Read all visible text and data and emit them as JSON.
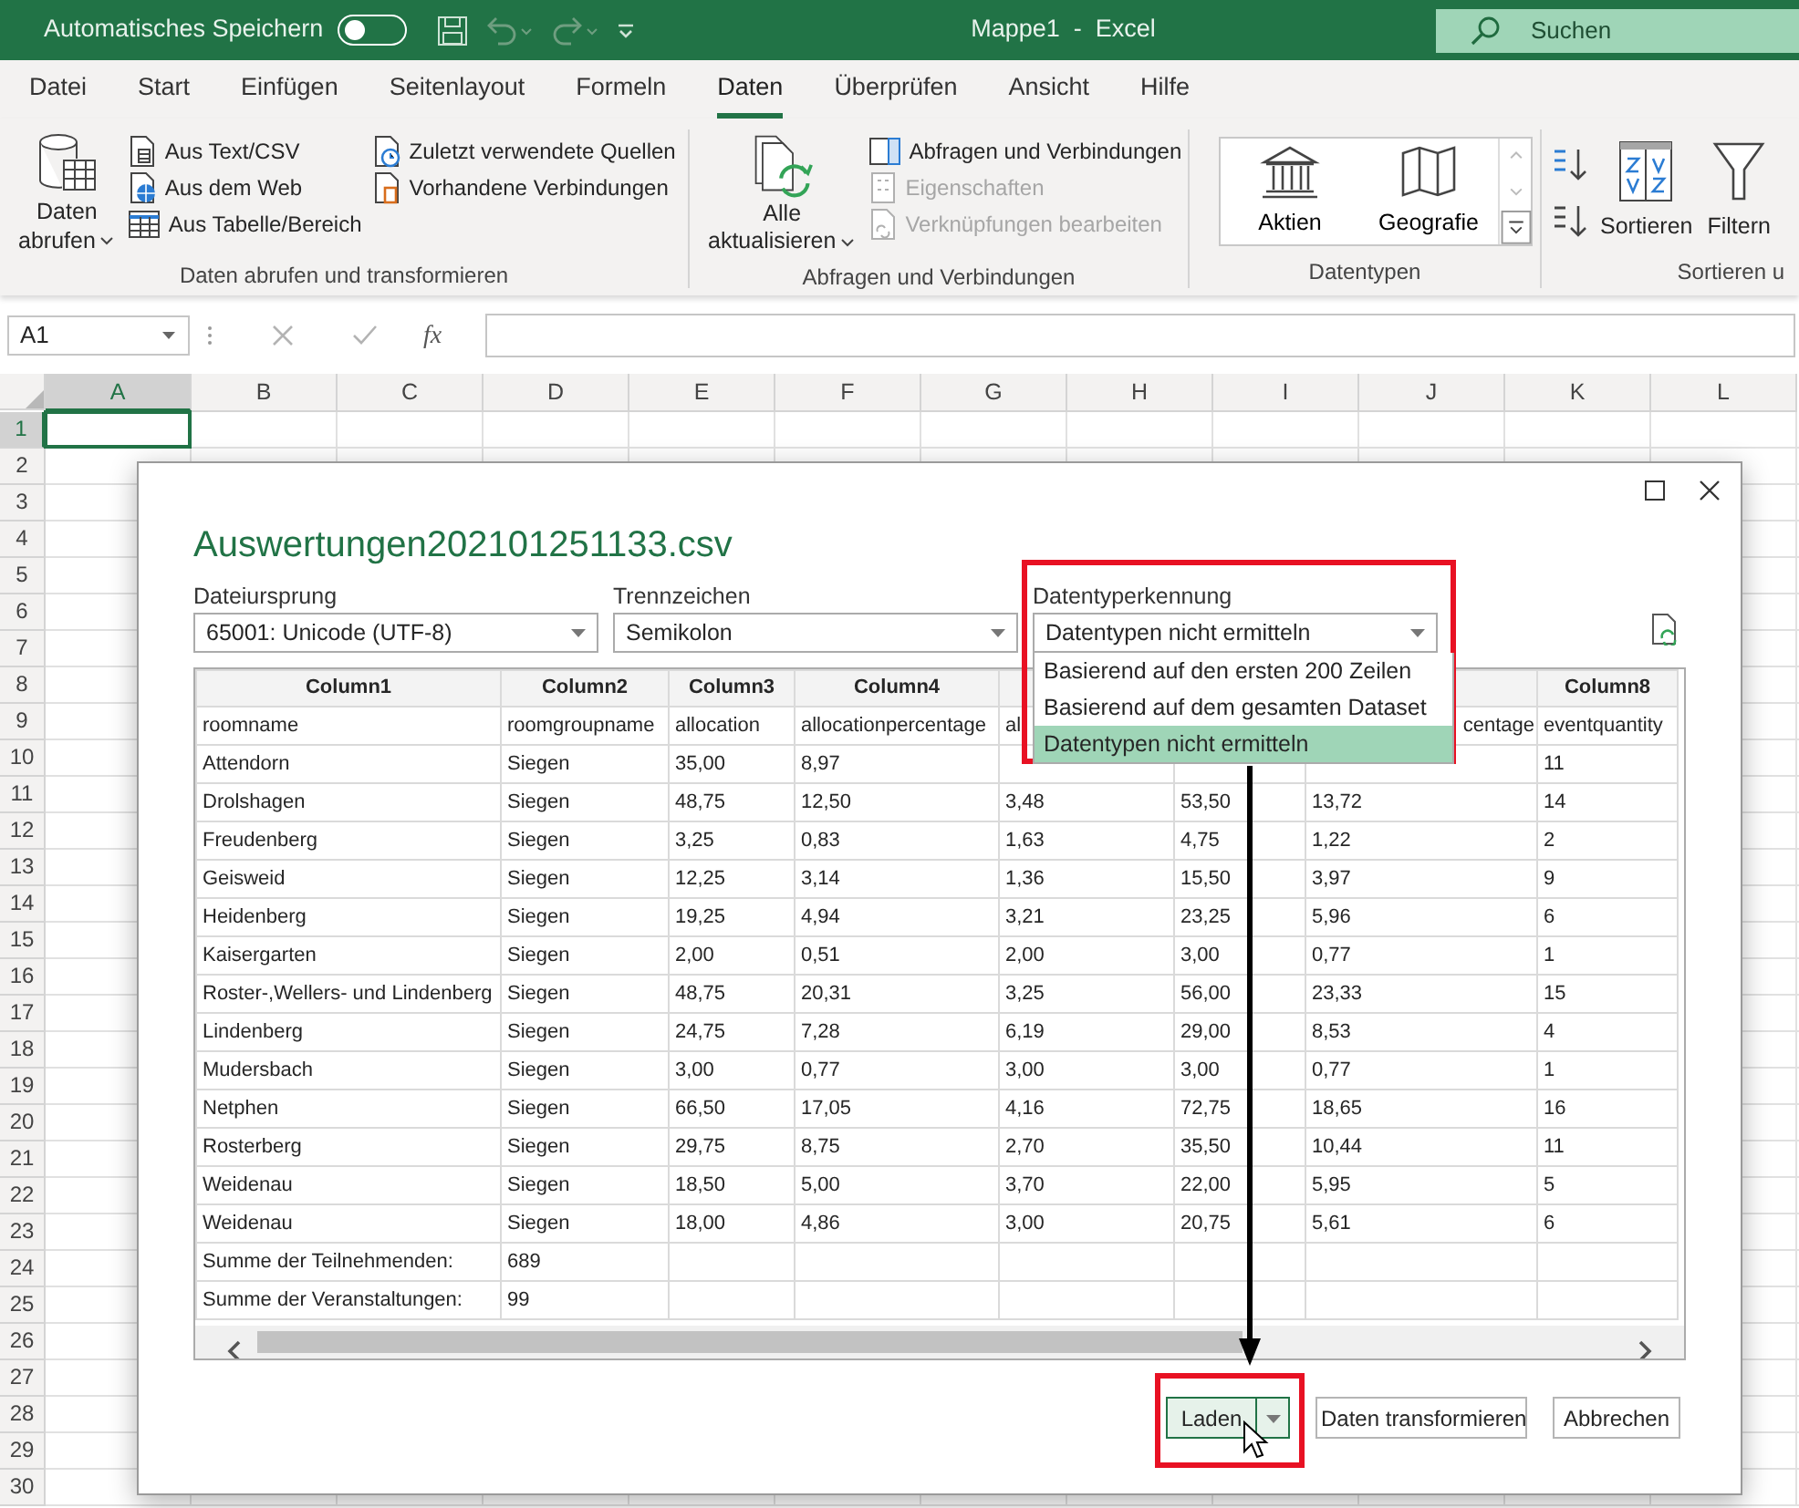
{
  "title_bar": {
    "autosave_label": "Automatisches Speichern",
    "autosave_on": false,
    "title": "Mappe1  -  Excel",
    "search_placeholder": "Suchen"
  },
  "menu_tabs": [
    {
      "label": "Datei",
      "selected": false
    },
    {
      "label": "Start",
      "selected": false
    },
    {
      "label": "Einfügen",
      "selected": false
    },
    {
      "label": "Seitenlayout",
      "selected": false
    },
    {
      "label": "Formeln",
      "selected": false
    },
    {
      "label": "Daten",
      "selected": true
    },
    {
      "label": "Überprüfen",
      "selected": false
    },
    {
      "label": "Ansicht",
      "selected": false
    },
    {
      "label": "Hilfe",
      "selected": false
    }
  ],
  "ribbon": [
    {
      "label": "Daten abrufen und transformieren",
      "items": [
        {
          "kind": "large",
          "label": "Daten\nabrufen",
          "has_menu": true,
          "disabled": false
        },
        {
          "kind": "small",
          "label": "Aus Text/CSV",
          "disabled": false
        },
        {
          "kind": "small",
          "label": "Aus dem Web",
          "disabled": false
        },
        {
          "kind": "small",
          "label": "Aus Tabelle/Bereich",
          "disabled": false
        },
        {
          "kind": "small",
          "label": "Zuletzt verwendete Quellen",
          "disabled": false
        },
        {
          "kind": "small",
          "label": "Vorhandene Verbindungen",
          "disabled": false
        }
      ]
    },
    {
      "label": "Abfragen und Verbindungen",
      "items": [
        {
          "kind": "large",
          "label": "Alle\naktualisieren",
          "has_menu": true,
          "disabled": false
        },
        {
          "kind": "small",
          "label": "Abfragen und Verbindungen",
          "disabled": false
        },
        {
          "kind": "small",
          "label": "Eigenschaften",
          "disabled": true
        },
        {
          "kind": "small",
          "label": "Verknüpfungen bearbeiten",
          "disabled": true
        }
      ]
    },
    {
      "label": "Datentypen",
      "items": [
        {
          "kind": "gallery",
          "tiles": [
            "Aktien",
            "Geografie"
          ]
        }
      ]
    },
    {
      "label": "Sortieren u",
      "items": [
        {
          "kind": "sort"
        },
        {
          "kind": "large",
          "label": "Sortieren",
          "has_menu": false,
          "disabled": false
        },
        {
          "kind": "large",
          "label": "Filtern",
          "has_menu": false,
          "disabled": false
        }
      ]
    }
  ],
  "formula_bar": {
    "name_box": "A1",
    "fx": "fx"
  },
  "sheet": {
    "columns": [
      {
        "label": "A",
        "selected": true
      },
      {
        "label": "B",
        "selected": false
      },
      {
        "label": "C",
        "selected": false
      },
      {
        "label": "D",
        "selected": false
      },
      {
        "label": "E",
        "selected": false
      },
      {
        "label": "F",
        "selected": false
      },
      {
        "label": "G",
        "selected": false
      },
      {
        "label": "H",
        "selected": false
      },
      {
        "label": "I",
        "selected": false
      },
      {
        "label": "J",
        "selected": false
      },
      {
        "label": "K",
        "selected": false
      },
      {
        "label": "L",
        "selected": false
      }
    ],
    "rows": [
      {
        "label": "1",
        "selected": true
      },
      {
        "label": "2",
        "selected": false
      },
      {
        "label": "3",
        "selected": false
      },
      {
        "label": "4",
        "selected": false
      },
      {
        "label": "5",
        "selected": false
      },
      {
        "label": "6",
        "selected": false
      },
      {
        "label": "7",
        "selected": false
      },
      {
        "label": "8",
        "selected": false
      },
      {
        "label": "9",
        "selected": false
      },
      {
        "label": "10",
        "selected": false
      },
      {
        "label": "11",
        "selected": false
      },
      {
        "label": "12",
        "selected": false
      },
      {
        "label": "13",
        "selected": false
      },
      {
        "label": "14",
        "selected": false
      },
      {
        "label": "15",
        "selected": false
      },
      {
        "label": "16",
        "selected": false
      },
      {
        "label": "17",
        "selected": false
      },
      {
        "label": "18",
        "selected": false
      },
      {
        "label": "19",
        "selected": false
      },
      {
        "label": "20",
        "selected": false
      },
      {
        "label": "21",
        "selected": false
      },
      {
        "label": "22",
        "selected": false
      },
      {
        "label": "23",
        "selected": false
      },
      {
        "label": "24",
        "selected": false
      },
      {
        "label": "25",
        "selected": false
      },
      {
        "label": "26",
        "selected": false
      },
      {
        "label": "27",
        "selected": false
      },
      {
        "label": "28",
        "selected": false
      },
      {
        "label": "29",
        "selected": false
      },
      {
        "label": "30",
        "selected": false
      }
    ]
  },
  "dialog": {
    "title": "Auswertungen202101251133.csv",
    "fields": [
      {
        "label": "Dateiursprung",
        "value": "65001: Unicode (UTF-8)"
      },
      {
        "label": "Trennzeichen",
        "value": "Semikolon"
      },
      {
        "label": "Datentyperkennung",
        "value": "Datentypen nicht ermitteln",
        "open": true,
        "options": [
          {
            "label": "Basierend auf den ersten 200 Zeilen",
            "selected": false
          },
          {
            "label": "Basierend auf dem gesamten Dataset",
            "selected": false
          },
          {
            "label": "Datentypen nicht ermitteln",
            "selected": true
          }
        ]
      }
    ],
    "table": {
      "columns": [
        "Column1",
        "Column2",
        "Column3",
        "Column4",
        null,
        null,
        null,
        "Column8"
      ],
      "rows": [
        [
          "roomname",
          "roomgroupname",
          "allocation",
          "allocationpercentage",
          "al",
          null,
          "centage",
          "eventquantity"
        ],
        [
          "Attendorn",
          "Siegen",
          "35,00",
          "8,97",
          null,
          null,
          null,
          "11"
        ],
        [
          "Drolshagen",
          "Siegen",
          "48,75",
          "12,50",
          "3,48",
          "53,50",
          "13,72",
          "14"
        ],
        [
          "Freudenberg",
          "Siegen",
          "3,25",
          "0,83",
          "1,63",
          "4,75",
          "1,22",
          "2"
        ],
        [
          "Geisweid",
          "Siegen",
          "12,25",
          "3,14",
          "1,36",
          "15,50",
          "3,97",
          "9"
        ],
        [
          "Heidenberg",
          "Siegen",
          "19,25",
          "4,94",
          "3,21",
          "23,25",
          "5,96",
          "6"
        ],
        [
          "Kaisergarten",
          "Siegen",
          "2,00",
          "0,51",
          "2,00",
          "3,00",
          "0,77",
          "1"
        ],
        [
          "Roster-,Wellers- und Lindenberg",
          "Siegen",
          "48,75",
          "20,31",
          "3,25",
          "56,00",
          "23,33",
          "15"
        ],
        [
          "Lindenberg",
          "Siegen",
          "24,75",
          "7,28",
          "6,19",
          "29,00",
          "8,53",
          "4"
        ],
        [
          "Mudersbach",
          "Siegen",
          "3,00",
          "0,77",
          "3,00",
          "3,00",
          "0,77",
          "1"
        ],
        [
          "Netphen",
          "Siegen",
          "66,50",
          "17,05",
          "4,16",
          "72,75",
          "18,65",
          "16"
        ],
        [
          "Rosterberg",
          "Siegen",
          "29,75",
          "8,75",
          "2,70",
          "35,50",
          "10,44",
          "11"
        ],
        [
          "Weidenau",
          "Siegen",
          "18,50",
          "5,00",
          "3,70",
          "22,00",
          "5,95",
          "5"
        ],
        [
          "Weidenau",
          "Siegen",
          "18,00",
          "4,86",
          "3,00",
          "20,75",
          "5,61",
          "6"
        ],
        [
          "Summe der Teilnehmenden:",
          "689"
        ],
        [
          "Summe der Veranstaltungen:",
          "99"
        ]
      ]
    },
    "buttons": [
      {
        "label": "Laden",
        "kind": "split",
        "highlighted": true
      },
      {
        "label": "Daten transformieren",
        "kind": "default",
        "highlighted": false
      },
      {
        "label": "Abbrechen",
        "kind": "default",
        "highlighted": false
      }
    ]
  }
}
